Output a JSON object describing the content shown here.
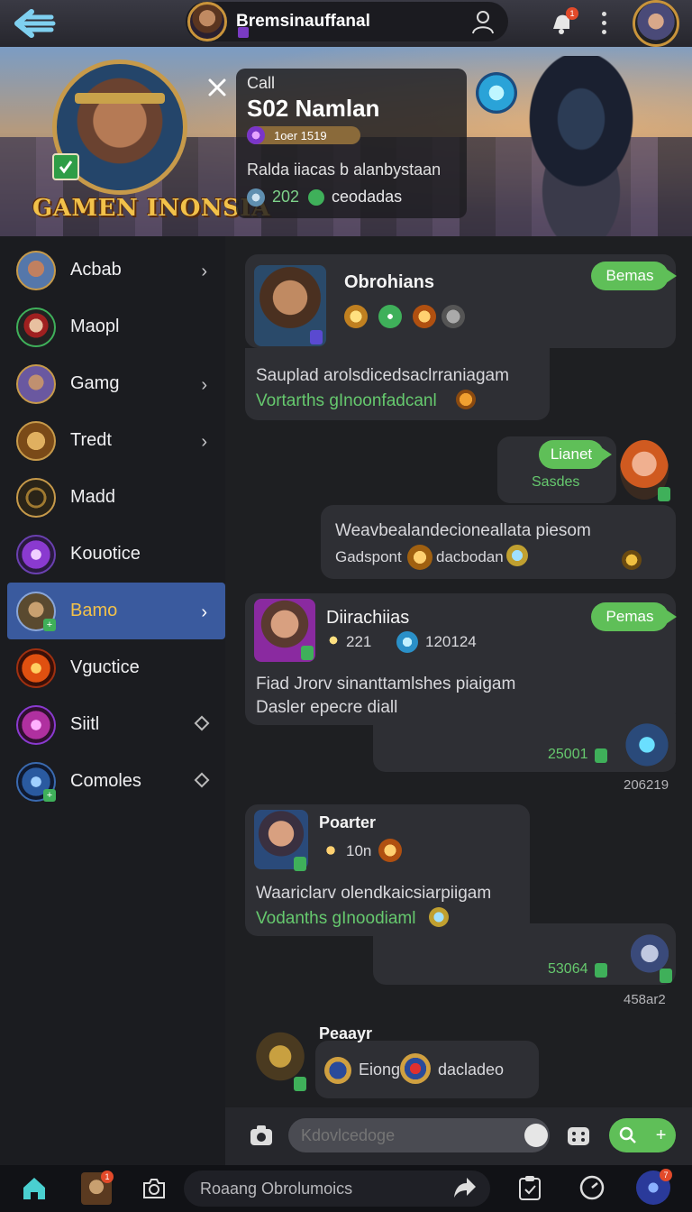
{
  "topbar": {
    "username": "Bremsinauffanal",
    "notifications": "1"
  },
  "hero": {
    "game_title": "GAMEN INONSIA",
    "call_card": {
      "kicker": "Call",
      "title": "S02 Namlan",
      "rank": "1oer 1519",
      "description": "Ralda iiacas b alanbystaan",
      "stat_count": "202",
      "stat_label": "ceodadas"
    }
  },
  "sidebar": {
    "items": [
      {
        "label": "Acbab",
        "trail": "chevron"
      },
      {
        "label": "Maopl",
        "trail": "none"
      },
      {
        "label": "Gamg",
        "trail": "chevron"
      },
      {
        "label": "Tredt",
        "trail": "chevron"
      },
      {
        "label": "Madd",
        "trail": "none"
      },
      {
        "label": "Kouotice",
        "trail": "none"
      },
      {
        "label": "Bamo",
        "trail": "chevron",
        "active": true
      },
      {
        "label": "Vguctice",
        "trail": "none"
      },
      {
        "label": "Siitl",
        "trail": "diamond"
      },
      {
        "label": "Comoles",
        "trail": "diamond"
      }
    ]
  },
  "chat": {
    "messages": [
      {
        "name": "Obrohians",
        "tag": "Bemas",
        "body": "Sauplad arolsdicedsaclrraniagam",
        "link": "Vortarths gInoonfadcanl"
      },
      {
        "outgoing_tag": "Lianet",
        "outgoing_small": "Sasdes",
        "body": "Weavbealandecioneallata piesom",
        "subline_a": "Gadspont",
        "subline_b": "dacbodan"
      },
      {
        "name": "Diirachiias",
        "tag": "Pemas",
        "stat_a": "221",
        "stat_b": "120124",
        "body_1": "Fiad Jrorv sinanttamlshes piaigam",
        "body_2": "Dasler epecre diall",
        "small": "25001",
        "time": "206219"
      },
      {
        "name": "Poarter",
        "stat_a": "10n",
        "body": "Waariclarv olendkaicsiarpiigam",
        "link": "Vodanths gInoodiaml",
        "small": "53064",
        "time": "458ar2"
      },
      {
        "name": "Peaayr",
        "chip_a": "Eiong",
        "chip_b": "dacladeo"
      }
    ]
  },
  "composer": {
    "placeholder": "Kdovlcedoge"
  },
  "bottomnav": {
    "search_text": "Roaang Obrolumoics",
    "badge_a": "1",
    "badge_b": "7"
  },
  "colors": {
    "accent_green": "#5fbf58",
    "active_blue": "#3a5a9e",
    "gold": "#f2c14a"
  }
}
